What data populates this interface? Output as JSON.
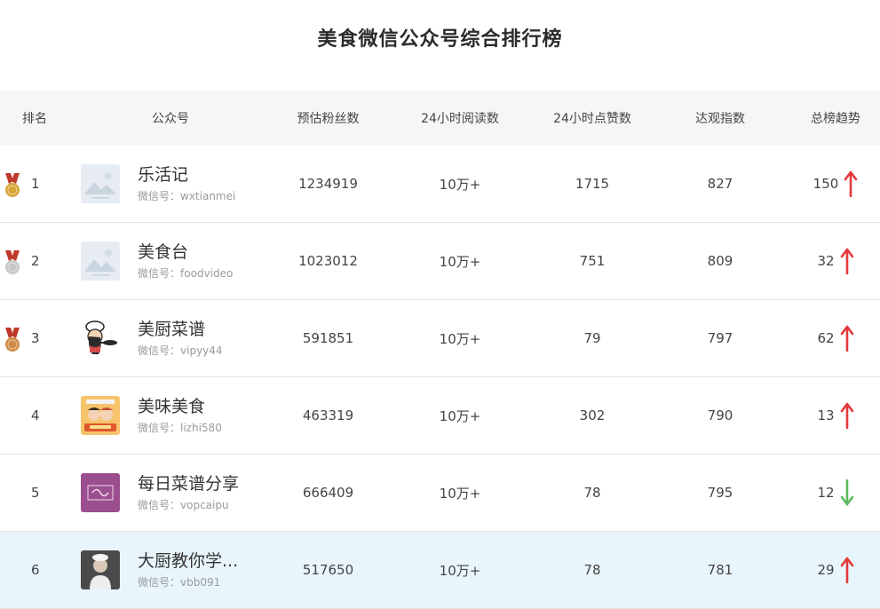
{
  "title": "美食微信公众号综合排行榜",
  "columns": [
    "排名",
    "公众号",
    "预估粉丝数",
    "24小时阅读数",
    "24小时点赞数",
    "达观指数",
    "总榜趋势"
  ],
  "id_prefix": "微信号：",
  "colors": {
    "up": "#e5383b",
    "down": "#5cb85c",
    "gold": "#d7a538",
    "silver": "#c7c7c7",
    "bronze": "#cf8a45",
    "ribbon": "#c0392b",
    "highlight_row": "#e9f5fd",
    "header_bg": "#f5f6f8"
  },
  "rows": [
    {
      "rank": "1",
      "medal": "gold",
      "avatar": "placeholder-image",
      "name": "乐活记",
      "id": "wxtianmei",
      "fans": "1234919",
      "reads": "10万+",
      "likes": "1715",
      "index": "827",
      "trend": "150",
      "dir": "up"
    },
    {
      "rank": "2",
      "medal": "silver",
      "avatar": "placeholder-image",
      "name": "美食台",
      "id": "foodvideo",
      "fans": "1023012",
      "reads": "10万+",
      "likes": "751",
      "index": "809",
      "trend": "32",
      "dir": "up"
    },
    {
      "rank": "3",
      "medal": "bronze",
      "avatar": "chef-cartoon",
      "name": "美厨菜谱",
      "id": "vipyy44",
      "fans": "591851",
      "reads": "10万+",
      "likes": "79",
      "index": "797",
      "trend": "62",
      "dir": "up"
    },
    {
      "rank": "4",
      "medal": "",
      "avatar": "cooking-cartoon",
      "name": "美味美食",
      "id": "lizhi580",
      "fans": "463319",
      "reads": "10万+",
      "likes": "302",
      "index": "790",
      "trend": "13",
      "dir": "up"
    },
    {
      "rank": "5",
      "medal": "",
      "avatar": "purple-logo",
      "name": "每日菜谱分享",
      "id": "vopcaipu",
      "fans": "666409",
      "reads": "10万+",
      "likes": "78",
      "index": "795",
      "trend": "12",
      "dir": "down"
    },
    {
      "rank": "6",
      "medal": "",
      "avatar": "chef-photo",
      "name": "大厨教你学...",
      "id": "vbb091",
      "fans": "517650",
      "reads": "10万+",
      "likes": "78",
      "index": "781",
      "trend": "29",
      "dir": "up"
    }
  ]
}
